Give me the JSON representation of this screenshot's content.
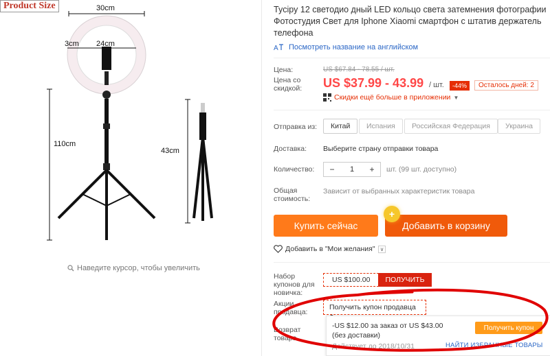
{
  "image_panel": {
    "product_size_tag": "Product Size",
    "dims": {
      "ring_diameter": "30cm",
      "inner_ring": "24cm",
      "ring_edge": "3cm",
      "stand_height": "110cm",
      "folded_height": "43cm"
    },
    "zoom_hint": "Наведите курсор, чтобы увеличить"
  },
  "product": {
    "title": "Tycipy 12 светодио дный LED кольцо света затемнения фотографии Фотостудия Свет для Iphone Xiaomi смартфон с штатив держатель телефона",
    "translate_link": "Посмотреть название на английском"
  },
  "price": {
    "label": "Цена:",
    "old": "US $67.84 - 78.55 / шт.",
    "discount_label": "Цена со скидкой:",
    "sale": "US $37.99 - 43.99",
    "per_unit": "/ шт.",
    "discount_badge": "-44%",
    "days_left": "Осталось дней: 2",
    "app_discount": "Скидки ещё больше в приложении"
  },
  "shipping": {
    "from_label": "Отправка из:",
    "options": [
      "Китай",
      "Испания",
      "Российская Федерация",
      "Украина"
    ],
    "delivery_label": "Доставка:",
    "delivery_value": "Выберите страну отправки товара"
  },
  "quantity": {
    "label": "Количество:",
    "value": "1",
    "minus": "−",
    "plus": "+",
    "available": "шт. (99 шт. доступно)"
  },
  "total": {
    "label": "Общая стоимость:",
    "value": "Зависит от выбранных характеристик товара"
  },
  "actions": {
    "buy": "Купить сейчас",
    "cart": "Добавить в корзину",
    "cart_badge": "+",
    "wishlist": "Добавить в \"Мои желания\"",
    "wishlist_chevron": "∨"
  },
  "coupons": {
    "new_user_label": "Набор купонов для новичка:",
    "new_user_value": "US $100.00",
    "get_label": "ПОЛУЧИТЬ",
    "seller_label": "Акции продавца:",
    "seller_coupon": "Получить купон продавца",
    "return_label": "Возврат товара",
    "popup_line1": "-US $12.00 за заказ от US $43.00",
    "popup_line2": "(без доставки)",
    "popup_line3": "Действует до 2018/10/31",
    "popup_button": "Получить купон",
    "fav_link": "НАЙТИ ИЗБРАННЫЕ ТОВАРЫ"
  },
  "colors": {
    "accent_red": "#ff4747",
    "buy_orange": "#ff7a1a",
    "cart_orange": "#f05a0a",
    "annotation_red": "#e00000",
    "link_blue": "#2b67c6"
  }
}
